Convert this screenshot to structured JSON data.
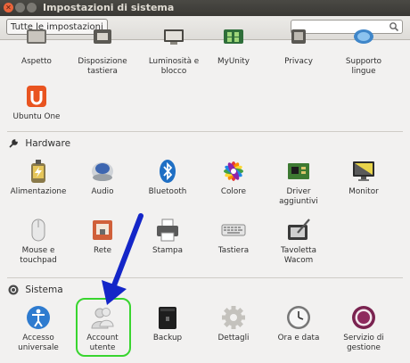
{
  "window": {
    "title": "Impostazioni di sistema"
  },
  "toolbar": {
    "all_settings_label": "Tutte le impostazioni",
    "search_value": ""
  },
  "personal": {
    "items": [
      {
        "label": "Aspetto",
        "icon": "appearance-icon"
      },
      {
        "label": "Disposizione tastiera",
        "icon": "keyboard-layout-icon"
      },
      {
        "label": "Luminosità e blocco",
        "icon": "brightness-lock-icon"
      },
      {
        "label": "MyUnity",
        "icon": "myunity-icon"
      },
      {
        "label": "Privacy",
        "icon": "privacy-icon"
      },
      {
        "label": "Supporto lingue",
        "icon": "language-support-icon"
      },
      {
        "label": "Ubuntu One",
        "icon": "ubuntu-one-icon"
      }
    ]
  },
  "hardware": {
    "title": "Hardware",
    "items": [
      {
        "label": "Alimentazione",
        "icon": "power-icon"
      },
      {
        "label": "Audio",
        "icon": "audio-icon"
      },
      {
        "label": "Bluetooth",
        "icon": "bluetooth-icon"
      },
      {
        "label": "Colore",
        "icon": "color-icon"
      },
      {
        "label": "Driver aggiuntivi",
        "icon": "additional-drivers-icon"
      },
      {
        "label": "Monitor",
        "icon": "monitor-icon"
      },
      {
        "label": "Mouse e touchpad",
        "icon": "mouse-icon"
      },
      {
        "label": "Rete",
        "icon": "network-icon"
      },
      {
        "label": "Stampa",
        "icon": "printer-icon"
      },
      {
        "label": "Tastiera",
        "icon": "keyboard-icon"
      },
      {
        "label": "Tavoletta Wacom",
        "icon": "wacom-tablet-icon"
      }
    ]
  },
  "system": {
    "title": "Sistema",
    "items": [
      {
        "label": "Accesso universale",
        "icon": "universal-access-icon"
      },
      {
        "label": "Account utente",
        "icon": "user-accounts-icon"
      },
      {
        "label": "Backup",
        "icon": "backup-icon"
      },
      {
        "label": "Dettagli",
        "icon": "details-gear-icon"
      },
      {
        "label": "Ora e data",
        "icon": "clock-icon"
      },
      {
        "label": "Servizio di gestione",
        "icon": "management-service-icon"
      }
    ]
  },
  "annotation": {
    "arrow_color": "#1426c8",
    "highlight_color": "#39d52f"
  }
}
